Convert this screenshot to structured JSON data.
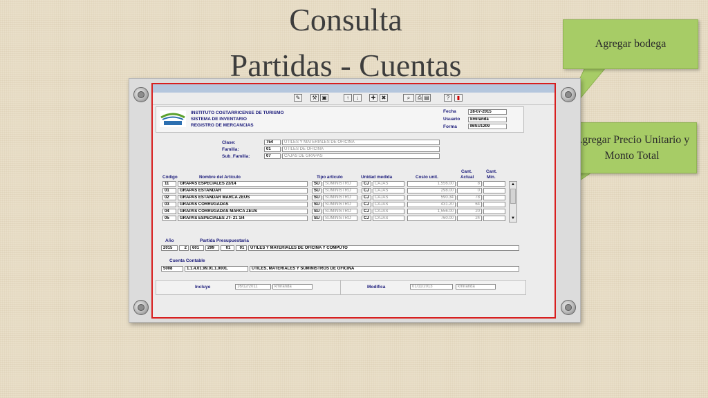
{
  "slide": {
    "title_line1": "Consulta",
    "title_line2": "Partidas - Cuentas"
  },
  "callouts": {
    "bodega": "Agregar bodega",
    "precio": "Agregar Precio Unitario y Monto Total"
  },
  "colors": {
    "callout": "#a7cc66",
    "frame_border": "#d81e1e",
    "label_blue": "#1a1a7a"
  },
  "app": {
    "header": {
      "line1": "INSTITUTO COSTARRICENSE DE TURISMO",
      "line2": "SISTEMA DE INVENTARIO",
      "line3": "REGISTRO DE MERCANCIAS",
      "fecha_label": "Fecha",
      "fecha_value": "28-07-2015",
      "usuario_label": "Usuario",
      "usuario_value": "kmiranda",
      "forma_label": "Forma",
      "forma_value": "IMSU1209"
    },
    "clase": {
      "label": "Clase:",
      "code": "754",
      "desc": "UTILES Y MATERIALES DE OFICINA"
    },
    "familia": {
      "label": "Familia:",
      "code": "01",
      "desc": "UTILES DE OFICINA"
    },
    "subfamilia": {
      "label": "Sub_Familia:",
      "code": "07",
      "desc": "CAJAS DE GRAPAS"
    },
    "columns": {
      "codigo": "Código",
      "nombre": "Nombre del Artículo",
      "tipo": "Tipo articulo",
      "unidad": "Unidad medida",
      "costo": "Costo unit.",
      "cant_actual_1": "Cant.",
      "cant_actual_2": "Actual",
      "cant_min_1": "Cant.",
      "cant_min_2": "Min."
    },
    "rows": [
      {
        "code": "11",
        "name": "GRAPAS ESPECIALES 23/14",
        "tipo": "SU",
        "tipo_desc": "SUMINISTRO",
        "unidad": "CJ",
        "unidad_desc": "CAJAS",
        "costo": "1,556.00",
        "actual": "8"
      },
      {
        "code": "01",
        "name": "GRAPAS ESTANDAR",
        "tipo": "SU",
        "tipo_desc": "SUMINISTRO",
        "unidad": "CJ",
        "unidad_desc": "CAJAS",
        "costo": "298.00",
        "actual": "0"
      },
      {
        "code": "02",
        "name": "GRAPAS ESTANDAR MARCA ZEUS",
        "tipo": "SU",
        "tipo_desc": "SUMINISTRO",
        "unidad": "CJ",
        "unidad_desc": "CAJAS",
        "costo": "590.34",
        "actual": "78"
      },
      {
        "code": "03",
        "name": "GRAPAS CORRUGADAS",
        "tipo": "SU",
        "tipo_desc": "SUMINISTRO",
        "unidad": "CJ",
        "unidad_desc": "CAJAS",
        "costo": "431.20",
        "actual": "64"
      },
      {
        "code": "04",
        "name": "GRAPAS CORRUGADAS MARCA ZEUS",
        "tipo": "SU",
        "tipo_desc": "SUMINISTRO",
        "unidad": "CJ",
        "unidad_desc": "CAJAS",
        "costo": "1,556.00",
        "actual": "20"
      },
      {
        "code": "05",
        "name": "GRAPAS ESPECIALES JT- 21 1/4",
        "tipo": "SU",
        "tipo_desc": "SUMINISTRO",
        "unidad": "CJ",
        "unidad_desc": "CAJAS",
        "costo": "760.00",
        "actual": "24"
      }
    ],
    "partida": {
      "anio_label": "Año",
      "label": "Partida Presupuestaria",
      "anio": "2015",
      "p1": "2",
      "p2": "601",
      "p3": "299",
      "p4": "01",
      "p5": "01",
      "desc": "ÚTILES Y MATERIALES DE OFICINA Y COMPUTO"
    },
    "cuenta": {
      "label": "Cuenta Contable",
      "code": "5008",
      "number": "1.1.4.01.99.01.1.0001.",
      "desc": "ÚTILES, MATERIALES Y SUMINISTROS DE OFICINA"
    },
    "audit": {
      "incluye_label": "Incluye",
      "incluye_date": "16/12/2011",
      "incluye_user": "kmiranda",
      "modifica_label": "Modifica",
      "modifica_date": "01/11/2013",
      "modifica_user": "kmiranda"
    }
  }
}
